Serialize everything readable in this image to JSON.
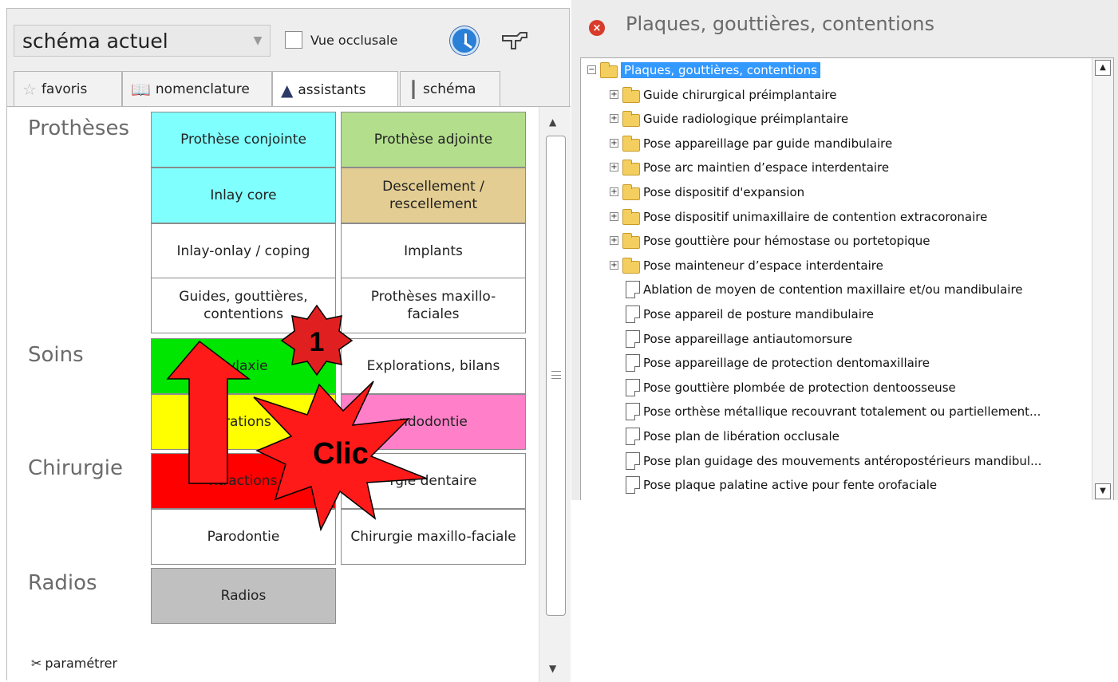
{
  "left": {
    "schema_select": "schéma actuel",
    "occlusal_label": "Vue occlusale",
    "tabs": [
      {
        "label": "favoris",
        "icon": "star-icon"
      },
      {
        "label": "nomenclature",
        "icon": "book-icon"
      },
      {
        "label": "assistants",
        "icon": "wizard-hat-icon"
      },
      {
        "label": "schéma",
        "icon": "tooth-icon"
      }
    ],
    "sections": {
      "protheses": "Prothèses",
      "soins": "Soins",
      "chirurgie": "Chirurgie",
      "radios": "Radios"
    },
    "buttons": {
      "prothese_conjointe": "Prothèse conjointe",
      "prothese_adjointe": "Prothèse adjointe",
      "inlay_core": "Inlay core",
      "descellement": "Descellement / rescellement",
      "inlay_onlay": "Inlay-onlay / coping",
      "implants": "Implants",
      "guides": "Guides, gouttières, contentions",
      "protheses_maxillo": "Prothèses maxillo-faciales",
      "prophylaxie": "nylaxie",
      "explorations": "Explorations, bilans",
      "obturations": "urations",
      "endodontie": "ndodontie",
      "extractions": "xtractions",
      "chirurgie_dentaire": "rgie dentaire",
      "parodontie": "Parodontie",
      "chirurgie_maxillo": "Chirurgie maxillo-faciale",
      "radios": "Radios"
    },
    "param_label": "paramétrer"
  },
  "colors": {
    "cyan": "#80ffff",
    "green_light": "#b3df8d",
    "tan": "#e3cd92",
    "green": "#00e600",
    "yellow": "#ffff00",
    "pink": "#ff80c8",
    "red": "#ff0000",
    "gray": "#c0c0c0",
    "selection": "#3399ff"
  },
  "annotations": {
    "badge_number": "1",
    "burst_label": "Clic"
  },
  "right": {
    "title": "Plaques, gouttières, contentions",
    "tree": [
      {
        "label": "Plaques, gouttières, contentions",
        "type": "folder",
        "level": 0,
        "expander": "−",
        "selected": true
      },
      {
        "label": "Guide chirurgical préimplantaire",
        "type": "folder",
        "level": 1,
        "expander": "+"
      },
      {
        "label": "Guide radiologique préimplantaire",
        "type": "folder",
        "level": 1,
        "expander": "+"
      },
      {
        "label": "Pose appareillage par guide mandibulaire",
        "type": "folder",
        "level": 1,
        "expander": "+"
      },
      {
        "label": "Pose arc maintien d’espace interdentaire",
        "type": "folder",
        "level": 1,
        "expander": "+"
      },
      {
        "label": "Pose dispositif d'expansion",
        "type": "folder",
        "level": 1,
        "expander": "+"
      },
      {
        "label": "Pose dispositif unimaxillaire de contention extracoronaire",
        "type": "folder",
        "level": 1,
        "expander": "+"
      },
      {
        "label": "Pose gouttière pour hémostase ou portetopique",
        "type": "folder",
        "level": 1,
        "expander": "+"
      },
      {
        "label": "Pose mainteneur d’espace interdentaire",
        "type": "folder",
        "level": 1,
        "expander": "+"
      },
      {
        "label": "Ablation de moyen de contention maxillaire et/ou mandibulaire",
        "type": "doc",
        "level": 1
      },
      {
        "label": "Pose appareil de posture mandibulaire",
        "type": "doc",
        "level": 1
      },
      {
        "label": "Pose appareillage antiautomorsure",
        "type": "doc",
        "level": 1
      },
      {
        "label": "Pose appareillage de protection dentomaxillaire",
        "type": "doc",
        "level": 1
      },
      {
        "label": "Pose gouttière plombée de protection dentoosseuse",
        "type": "doc",
        "level": 1
      },
      {
        "label": "Pose orthèse métallique recouvrant totalement ou partiellement...",
        "type": "doc",
        "level": 1
      },
      {
        "label": "Pose plan de libération occlusale",
        "type": "doc",
        "level": 1
      },
      {
        "label": "Pose plan guidage des mouvements antéropostérieurs mandibul...",
        "type": "doc",
        "level": 1
      },
      {
        "label": "Pose plaque palatine active pour fente orofaciale",
        "type": "doc",
        "level": 1
      }
    ]
  }
}
